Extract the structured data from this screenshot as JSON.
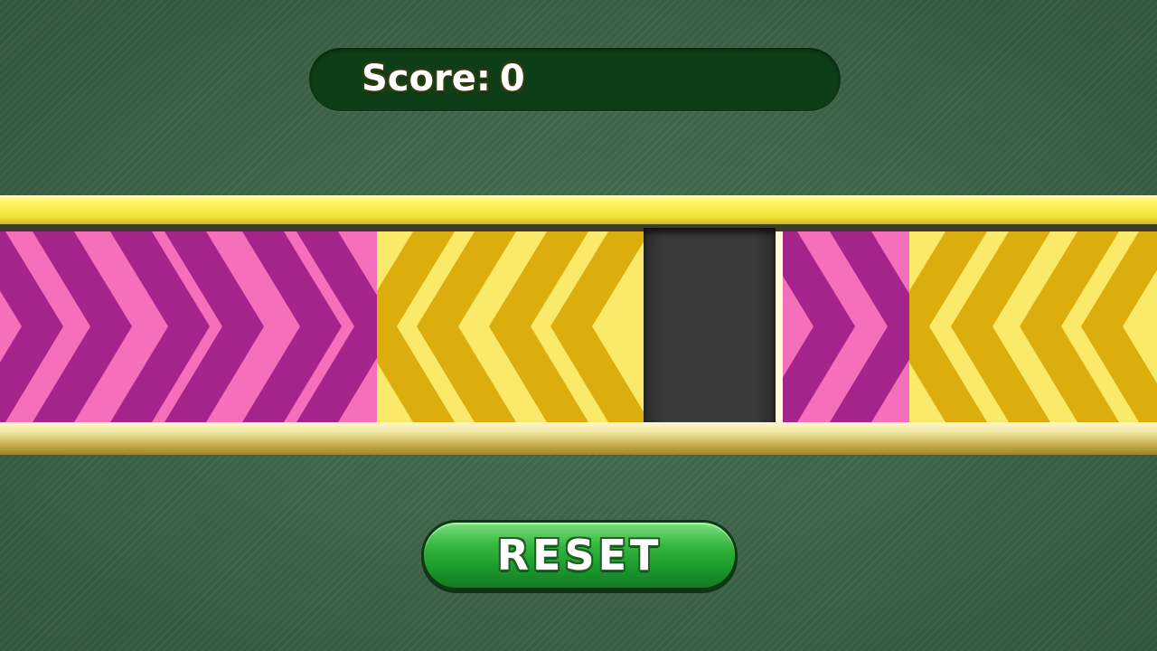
{
  "score": {
    "label": "Score:",
    "value": "0"
  },
  "reset": {
    "label": "RESET"
  },
  "tiles": [
    {
      "name": "pink-right-tile",
      "direction": "right",
      "chevrons": 3,
      "colors": {
        "light": "#f56fbb",
        "dark": "#a5248c"
      }
    },
    {
      "name": "yellow-left-tile",
      "direction": "left",
      "chevrons": 2,
      "colors": {
        "light": "#fbe96a",
        "dark": "#dcae0d"
      }
    },
    {
      "name": "empty-slot",
      "direction": "none",
      "chevrons": 0,
      "colors": {
        "light": "#3a3a3a",
        "dark": "#2a2a2a"
      }
    },
    {
      "name": "pink-right-tile",
      "direction": "right",
      "chevrons": 1,
      "colors": {
        "light": "#f56fbb",
        "dark": "#a5248c"
      }
    },
    {
      "name": "yellow-left-tile",
      "direction": "left",
      "chevrons": 2,
      "colors": {
        "light": "#fbe96a",
        "dark": "#dcae0d"
      }
    }
  ],
  "colors": {
    "background": "#3f6b4c",
    "score_panel": "#0e3e17",
    "track_yellow": "#fff25a",
    "button_green": "#35b83f"
  }
}
